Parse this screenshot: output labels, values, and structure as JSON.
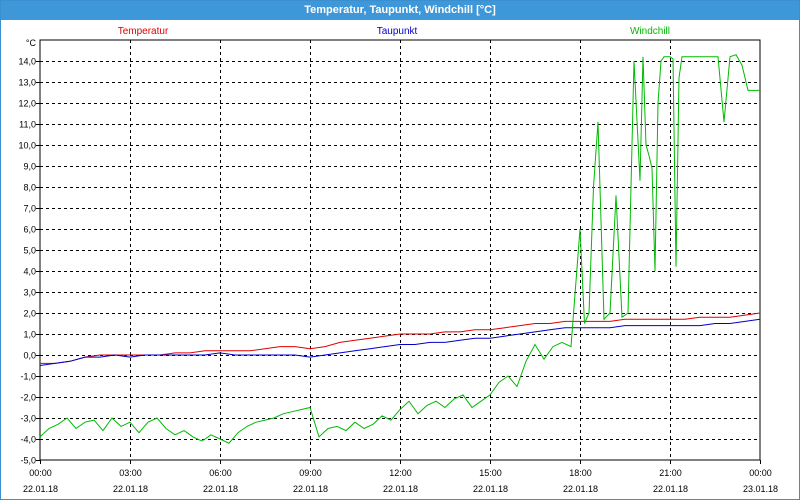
{
  "window": {
    "title": "Temperatur, Taupunkt, Windchill [°C]"
  },
  "chart_data": {
    "type": "line",
    "title": "Temperatur, Taupunkt, Windchill [°C]",
    "ylabel": "°C",
    "xlabel": "",
    "ylim": [
      -5.0,
      15.0
    ],
    "xlim": [
      0,
      24
    ],
    "grid": true,
    "legend_placement": "top",
    "y_ticks": [
      "-5,0",
      "-4,0",
      "-3,0",
      "-2,0",
      "-1,0",
      "0,0",
      "1,0",
      "2,0",
      "3,0",
      "4,0",
      "5,0",
      "6,0",
      "7,0",
      "8,0",
      "9,0",
      "10,0",
      "11,0",
      "12,0",
      "13,0",
      "14,0"
    ],
    "x_ticks": [
      {
        "time": "00:00",
        "date": "22.01.18"
      },
      {
        "time": "03:00",
        "date": "22.01.18"
      },
      {
        "time": "06:00",
        "date": "22.01.18"
      },
      {
        "time": "09:00",
        "date": "22.01.18"
      },
      {
        "time": "12:00",
        "date": "22.01.18"
      },
      {
        "time": "15:00",
        "date": "22.01.18"
      },
      {
        "time": "18:00",
        "date": "22.01.18"
      },
      {
        "time": "21:00",
        "date": "22.01.18"
      },
      {
        "time": "00:00",
        "date": "23.01.18"
      }
    ],
    "series": [
      {
        "name": "Temperatur",
        "color": "#e00000",
        "x": [
          0,
          0.5,
          1,
          1.5,
          2,
          2.5,
          3,
          3.5,
          4,
          4.5,
          5,
          5.5,
          6,
          6.5,
          7,
          7.5,
          8,
          8.5,
          9,
          9.5,
          10,
          10.5,
          11,
          11.5,
          12,
          12.5,
          13,
          13.5,
          14,
          14.5,
          15,
          15.5,
          16,
          16.5,
          17,
          17.5,
          18,
          18.5,
          19,
          19.5,
          20,
          20.5,
          21,
          21.5,
          22,
          22.5,
          23,
          23.5,
          24
        ],
        "values": [
          -0.4,
          -0.4,
          -0.3,
          -0.1,
          0.0,
          0.0,
          0.0,
          0.0,
          0.0,
          0.1,
          0.1,
          0.2,
          0.2,
          0.2,
          0.2,
          0.3,
          0.4,
          0.4,
          0.3,
          0.4,
          0.6,
          0.7,
          0.8,
          0.9,
          1.0,
          1.0,
          1.0,
          1.1,
          1.1,
          1.2,
          1.2,
          1.3,
          1.4,
          1.5,
          1.5,
          1.6,
          1.6,
          1.6,
          1.6,
          1.7,
          1.7,
          1.7,
          1.7,
          1.7,
          1.8,
          1.8,
          1.8,
          1.9,
          2.0
        ]
      },
      {
        "name": "Taupunkt",
        "color": "#0000cc",
        "x": [
          0,
          0.5,
          1,
          1.5,
          2,
          2.5,
          3,
          3.5,
          4,
          4.5,
          5,
          5.5,
          6,
          6.5,
          7,
          7.5,
          8,
          8.5,
          9,
          9.5,
          10,
          10.5,
          11,
          11.5,
          12,
          12.5,
          13,
          13.5,
          14,
          14.5,
          15,
          15.5,
          16,
          16.5,
          17,
          17.5,
          18,
          18.5,
          19,
          19.5,
          20,
          20.5,
          21,
          21.5,
          22,
          22.5,
          23,
          23.5,
          24
        ],
        "values": [
          -0.5,
          -0.4,
          -0.3,
          -0.1,
          -0.1,
          0.0,
          -0.1,
          0.0,
          0.0,
          0.0,
          0.0,
          0.0,
          0.1,
          0.0,
          0.0,
          0.0,
          0.0,
          0.0,
          -0.1,
          0.0,
          0.1,
          0.2,
          0.3,
          0.4,
          0.5,
          0.5,
          0.6,
          0.6,
          0.7,
          0.8,
          0.8,
          0.9,
          1.0,
          1.1,
          1.2,
          1.3,
          1.3,
          1.3,
          1.3,
          1.4,
          1.4,
          1.4,
          1.4,
          1.4,
          1.4,
          1.5,
          1.5,
          1.6,
          1.7
        ]
      },
      {
        "name": "Windchill",
        "color": "#00bb00",
        "x": [
          0,
          0.3,
          0.6,
          0.9,
          1.2,
          1.5,
          1.8,
          2.1,
          2.4,
          2.7,
          3.0,
          3.3,
          3.6,
          3.9,
          4.2,
          4.5,
          4.8,
          5.1,
          5.4,
          5.7,
          6.0,
          6.3,
          6.6,
          6.9,
          7.2,
          7.5,
          7.8,
          8.1,
          8.4,
          8.7,
          9.0,
          9.3,
          9.6,
          9.9,
          10.2,
          10.5,
          10.8,
          11.1,
          11.4,
          11.7,
          12.0,
          12.3,
          12.6,
          12.9,
          13.2,
          13.5,
          13.8,
          14.1,
          14.4,
          14.7,
          15.0,
          15.3,
          15.6,
          15.9,
          16.2,
          16.5,
          16.8,
          17.1,
          17.4,
          17.7,
          18.0,
          18.15,
          18.3,
          18.45,
          18.6,
          18.8,
          19.0,
          19.2,
          19.4,
          19.6,
          19.8,
          20.0,
          20.1,
          20.2,
          20.3,
          20.4,
          20.5,
          20.6,
          20.7,
          20.8,
          20.9,
          21.0,
          21.1,
          21.2,
          21.3,
          21.4,
          21.5,
          21.7,
          22.0,
          22.3,
          22.6,
          22.8,
          23.0,
          23.2,
          23.4,
          23.6,
          23.8,
          24.0
        ],
        "values": [
          -3.9,
          -3.5,
          -3.3,
          -3.0,
          -3.5,
          -3.2,
          -3.1,
          -3.6,
          -3.0,
          -3.4,
          -3.2,
          -3.7,
          -3.2,
          -3.0,
          -3.5,
          -3.8,
          -3.6,
          -3.9,
          -4.1,
          -3.8,
          -4.0,
          -4.2,
          -3.7,
          -3.4,
          -3.2,
          -3.1,
          -3.0,
          -2.8,
          -2.7,
          -2.6,
          -2.5,
          -3.9,
          -3.5,
          -3.4,
          -3.6,
          -3.2,
          -3.5,
          -3.3,
          -2.9,
          -3.1,
          -2.6,
          -2.2,
          -2.8,
          -2.4,
          -2.2,
          -2.5,
          -2.1,
          -1.9,
          -2.5,
          -2.2,
          -1.9,
          -1.3,
          -1.0,
          -1.5,
          -0.3,
          0.5,
          -0.2,
          0.4,
          0.6,
          0.4,
          6.0,
          1.5,
          2.0,
          8.0,
          11.1,
          1.7,
          2.0,
          7.6,
          1.8,
          2.0,
          14.0,
          8.3,
          14.2,
          10.0,
          9.5,
          8.9,
          4.0,
          12.0,
          14.0,
          14.2,
          14.2,
          14.2,
          14.1,
          4.2,
          13.2,
          14.2,
          14.2,
          14.2,
          14.2,
          14.2,
          14.2,
          11.1,
          14.2,
          14.3,
          13.8,
          12.6,
          12.6,
          12.6
        ]
      }
    ]
  }
}
